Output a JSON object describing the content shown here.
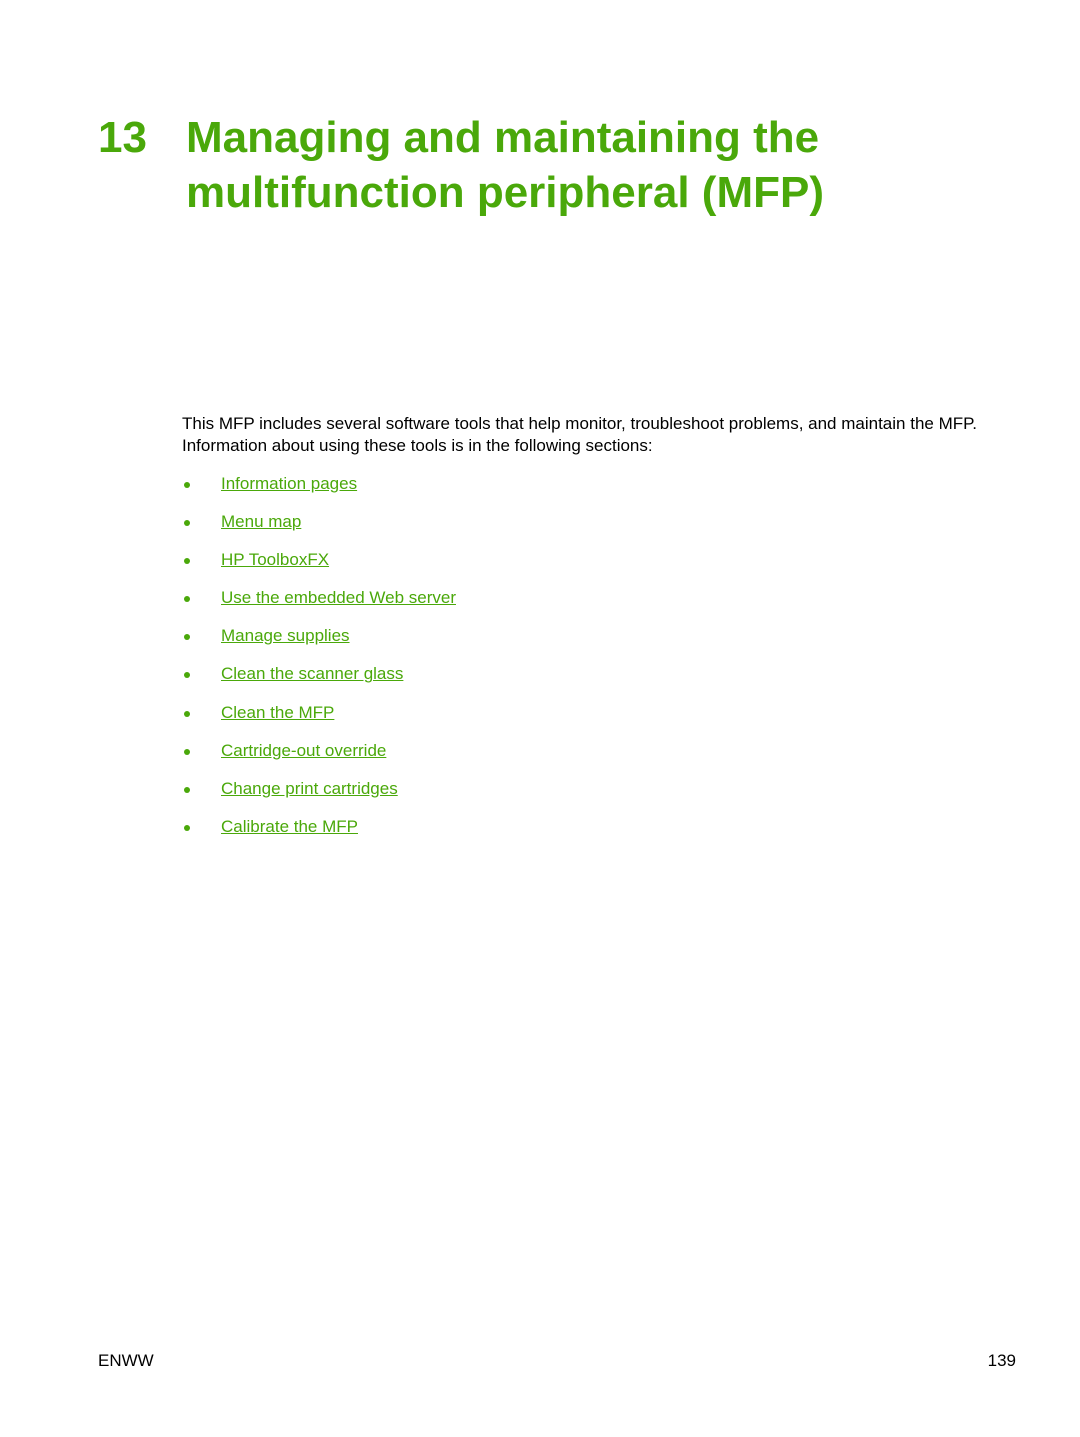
{
  "chapter": {
    "number": "13",
    "title": "Managing and maintaining the multifunction peripheral (MFP)",
    "color": "#4aa80a"
  },
  "intro": "This MFP includes several software tools that help monitor, troubleshoot problems, and maintain the MFP. Information about using these tools is in the following sections:",
  "links": [
    {
      "label": "Information pages"
    },
    {
      "label": "Menu map"
    },
    {
      "label": "HP ToolboxFX"
    },
    {
      "label": "Use the embedded Web server"
    },
    {
      "label": "Manage supplies"
    },
    {
      "label": "Clean the scanner glass"
    },
    {
      "label": "Clean the MFP"
    },
    {
      "label": "Cartridge-out override"
    },
    {
      "label": "Change print cartridges"
    },
    {
      "label": "Calibrate the MFP"
    }
  ],
  "footer": {
    "left": "ENWW",
    "page_number": "139"
  }
}
